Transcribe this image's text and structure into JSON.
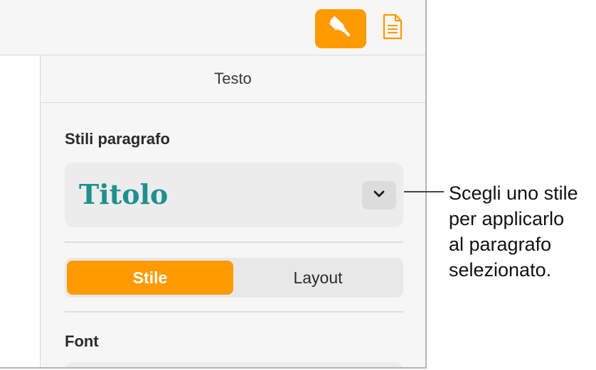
{
  "toolbar": {
    "format_button_icon": "paintbrush-icon",
    "document_button_icon": "document-icon",
    "accent_color": "#ff9a00"
  },
  "inspector": {
    "tab_title": "Testo",
    "paragraph_styles_label": "Stili paragrafo",
    "selected_style": "Titolo",
    "selected_style_color": "#1f8f8f",
    "segments": [
      "Stile",
      "Layout"
    ],
    "active_segment": "Stile",
    "font_label": "Font"
  },
  "callout": {
    "lines": [
      "Scegli uno stile",
      "per applicarlo",
      "al paragrafo",
      "selezionato."
    ]
  }
}
